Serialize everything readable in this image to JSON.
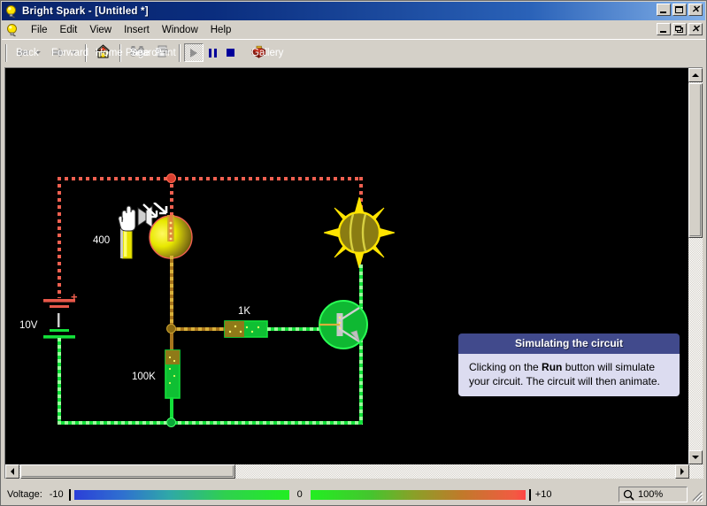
{
  "window": {
    "title": "Bright Spark - [Untitled *]",
    "app_icon": "lightbulb-icon",
    "buttons": {
      "minimize": "_",
      "maximize": "□",
      "close": "×"
    },
    "mdi_buttons": {
      "minimize": "_",
      "restore": "□",
      "close": "×"
    }
  },
  "menu": {
    "icon": "lightbulb-icon",
    "items": [
      {
        "label": "File"
      },
      {
        "label": "Edit"
      },
      {
        "label": "View"
      },
      {
        "label": "Insert"
      },
      {
        "label": "Window"
      },
      {
        "label": "Help"
      }
    ]
  },
  "toolbar": {
    "back": {
      "label": "Back",
      "icon": "arrow-left-icon",
      "enabled": false
    },
    "forward": {
      "label": "Forward",
      "icon": "arrow-right-icon",
      "enabled": false
    },
    "home": {
      "label": "Home Page",
      "icon": "house-icon",
      "enabled": true
    },
    "search": {
      "label": "Search",
      "icon": "binoculars-icon",
      "enabled": false
    },
    "print": {
      "label": "Print",
      "icon": "printer-icon",
      "enabled": false
    },
    "run": {
      "label": "Run",
      "icon": "play-icon",
      "enabled": false
    },
    "pause": {
      "label": "Pause",
      "icon": "pause-icon",
      "enabled": true
    },
    "stop": {
      "label": "Stop",
      "icon": "stop-icon",
      "enabled": true
    },
    "gallery": {
      "label": "Gallery",
      "icon": "gallery-box-icon",
      "enabled": true
    }
  },
  "tooltip": {
    "title": "Simulating the circuit",
    "body_pre": "Clicking on the ",
    "body_bold": "Run",
    "body_post": " button will simulate your circuit. The circuit will then animate."
  },
  "circuit": {
    "background": "#000000",
    "components": [
      {
        "name": "battery",
        "label": "10V",
        "terminal_plus": "+"
      },
      {
        "name": "variable-resistor",
        "label": "400"
      },
      {
        "name": "resistor-100k",
        "label": "100K"
      },
      {
        "name": "resistor-1k",
        "label": "1K"
      },
      {
        "name": "lamp",
        "label": ""
      },
      {
        "name": "transistor",
        "label": ""
      }
    ],
    "wire_colors": {
      "positive": "#f06050",
      "ground": "#13e03a",
      "mid": "#d9b03a"
    }
  },
  "statusbar": {
    "voltage_label": "Voltage:",
    "scale_min": "-10",
    "scale_mid": "0",
    "scale_max": "+10",
    "zoom_icon": "magnifier-icon",
    "zoom_level": "100%",
    "gradient_negative": [
      "#2b3fd8",
      "#2f6fd0",
      "#2fa8a8",
      "#2fd04f",
      "#22ee22"
    ],
    "gradient_positive": [
      "#22ee22",
      "#45c52e",
      "#8aa028",
      "#c07a2a",
      "#ff4444"
    ]
  },
  "scrollbars": {
    "vertical": {
      "up": "▲",
      "down": "▼"
    },
    "horizontal": {
      "left": "◄",
      "right": "►"
    }
  }
}
